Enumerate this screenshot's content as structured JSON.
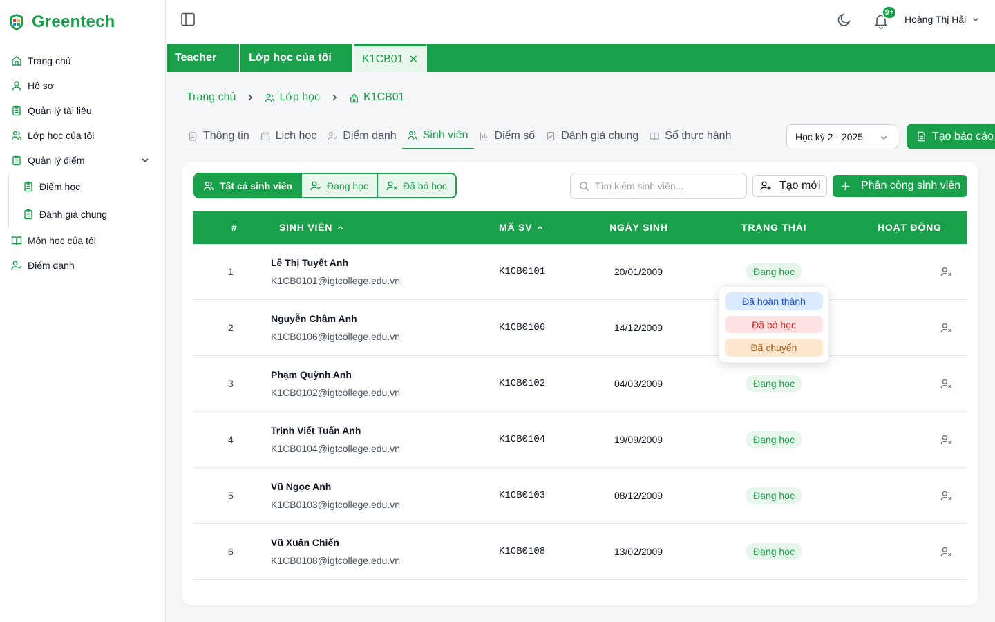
{
  "brand": {
    "name": "Greentech"
  },
  "sidebar": {
    "items": [
      {
        "label": "Trang chủ",
        "icon": "home-icon"
      },
      {
        "label": "Hồ sơ",
        "icon": "user-icon"
      },
      {
        "label": "Quản lý tài liệu",
        "icon": "clipboard-icon"
      },
      {
        "label": "Lớp học của tôi",
        "icon": "users-icon"
      },
      {
        "label": "Quản lý điểm",
        "icon": "clipboard-icon",
        "expanded": true,
        "children": [
          {
            "label": "Điểm học"
          },
          {
            "label": "Đánh giá chung"
          }
        ]
      },
      {
        "label": "Môn học của tôi",
        "icon": "book-icon"
      },
      {
        "label": "Điểm danh",
        "icon": "user-check-icon"
      }
    ]
  },
  "header": {
    "notification_count": "9+",
    "user_name": "Hoàng Thị Hải"
  },
  "tabs": [
    {
      "label": "Teacher",
      "active": false
    },
    {
      "label": "Lớp học của tôi",
      "active": false
    },
    {
      "label": "K1CB01",
      "active": true,
      "close": "✕"
    }
  ],
  "breadcrumb": {
    "home": "Trang chủ",
    "classes": "Lớp học",
    "current": "K1CB01"
  },
  "subtabs": [
    {
      "label": "Thông tin",
      "icon": "clipboard-icon"
    },
    {
      "label": "Lịch học",
      "icon": "calendar-icon"
    },
    {
      "label": "Điểm danh",
      "icon": "user-check-icon"
    },
    {
      "label": "Sinh viên",
      "icon": "users-icon",
      "active": true
    },
    {
      "label": "Điểm số",
      "icon": "bar-chart-icon"
    },
    {
      "label": "Đánh giá chung",
      "icon": "checklist-icon"
    },
    {
      "label": "Sổ thực hành",
      "icon": "book-icon"
    }
  ],
  "semester": {
    "selected": "Học kỳ 2 - 2025"
  },
  "report_button": "Tạo báo cáo",
  "filters": {
    "all": "Tất cả sinh viên",
    "studying": "Đang học",
    "dropped": "Đã bỏ học"
  },
  "search": {
    "placeholder": "Tìm kiếm sinh viên...",
    "value": ""
  },
  "create_button": "Tạo mới",
  "assign_button": "Phân công sinh viên",
  "table": {
    "columns": {
      "index": "#",
      "name": "SINH VIÊN",
      "code": "MÃ SV",
      "dob": "NGÀY SINH",
      "status": "TRẠNG THÁI",
      "actions": "HOẠT ĐỘNG"
    },
    "rows": [
      {
        "index": "1",
        "name": "Lê Thị Tuyết Anh",
        "email": "K1CB0101@igtcollege.edu.vn",
        "code": "K1CB0101",
        "dob": "20/01/2009",
        "status": "Đang học"
      },
      {
        "index": "2",
        "name": "Nguyễn Châm Anh",
        "email": "K1CB0106@igtcollege.edu.vn",
        "code": "K1CB0106",
        "dob": "14/12/2009",
        "status": ""
      },
      {
        "index": "3",
        "name": "Phạm Quỳnh Anh",
        "email": "K1CB0102@igtcollege.edu.vn",
        "code": "K1CB0102",
        "dob": "04/03/2009",
        "status": "Đang học"
      },
      {
        "index": "4",
        "name": "Trịnh Viết Tuấn Anh",
        "email": "K1CB0104@igtcollege.edu.vn",
        "code": "K1CB0104",
        "dob": "19/09/2009",
        "status": "Đang học"
      },
      {
        "index": "5",
        "name": "Vũ Ngọc Anh",
        "email": "K1CB0103@igtcollege.edu.vn",
        "code": "K1CB0103",
        "dob": "08/12/2009",
        "status": "Đang học"
      },
      {
        "index": "6",
        "name": "Vũ Xuân Chiến",
        "email": "K1CB0108@igtcollege.edu.vn",
        "code": "K1CB0108",
        "dob": "13/02/2009",
        "status": "Đang học"
      }
    ]
  },
  "status_dropdown": {
    "completed": "Đã hoàn thành",
    "dropped": "Đã bỏ học",
    "transferred": "Đã chuyển"
  },
  "colors": {
    "primary": "#1aa04a",
    "primary_light": "#e8f6ec",
    "completed": "#1d4ed8",
    "dropped": "#dc2626",
    "transferred": "#b45309"
  }
}
